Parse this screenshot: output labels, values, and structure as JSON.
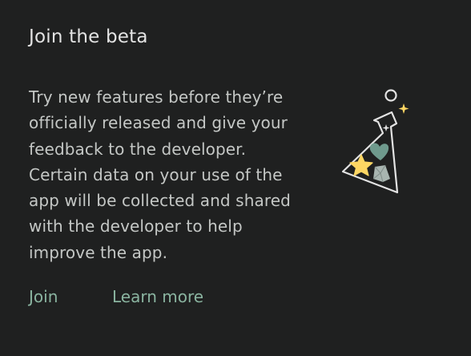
{
  "dialog": {
    "title": "Join the beta",
    "description_lines": [
      "Try new features before they’re",
      "officially released and give your",
      "feedback to the developer.",
      "Certain data on your use of the",
      "app will be collected and shared",
      "with the developer to help",
      "improve the app."
    ],
    "illustration": {
      "icon": "beaker-flask-icon",
      "contents": [
        "heart-icon",
        "star-icon",
        "gem-icon",
        "sparkle-icon",
        "bubble-icon"
      ],
      "colors": {
        "outline": "#e3e3e3",
        "star": "#fdd663",
        "heart": "#6f9a8d",
        "gem": "#a8b5b0"
      }
    },
    "actions": {
      "join_label": "Join",
      "learn_more_label": "Learn more"
    },
    "colors": {
      "background": "#1f2020",
      "title": "#e3e3e3",
      "body_text": "#c4c7c5",
      "accent": "#8ab4a0"
    }
  }
}
